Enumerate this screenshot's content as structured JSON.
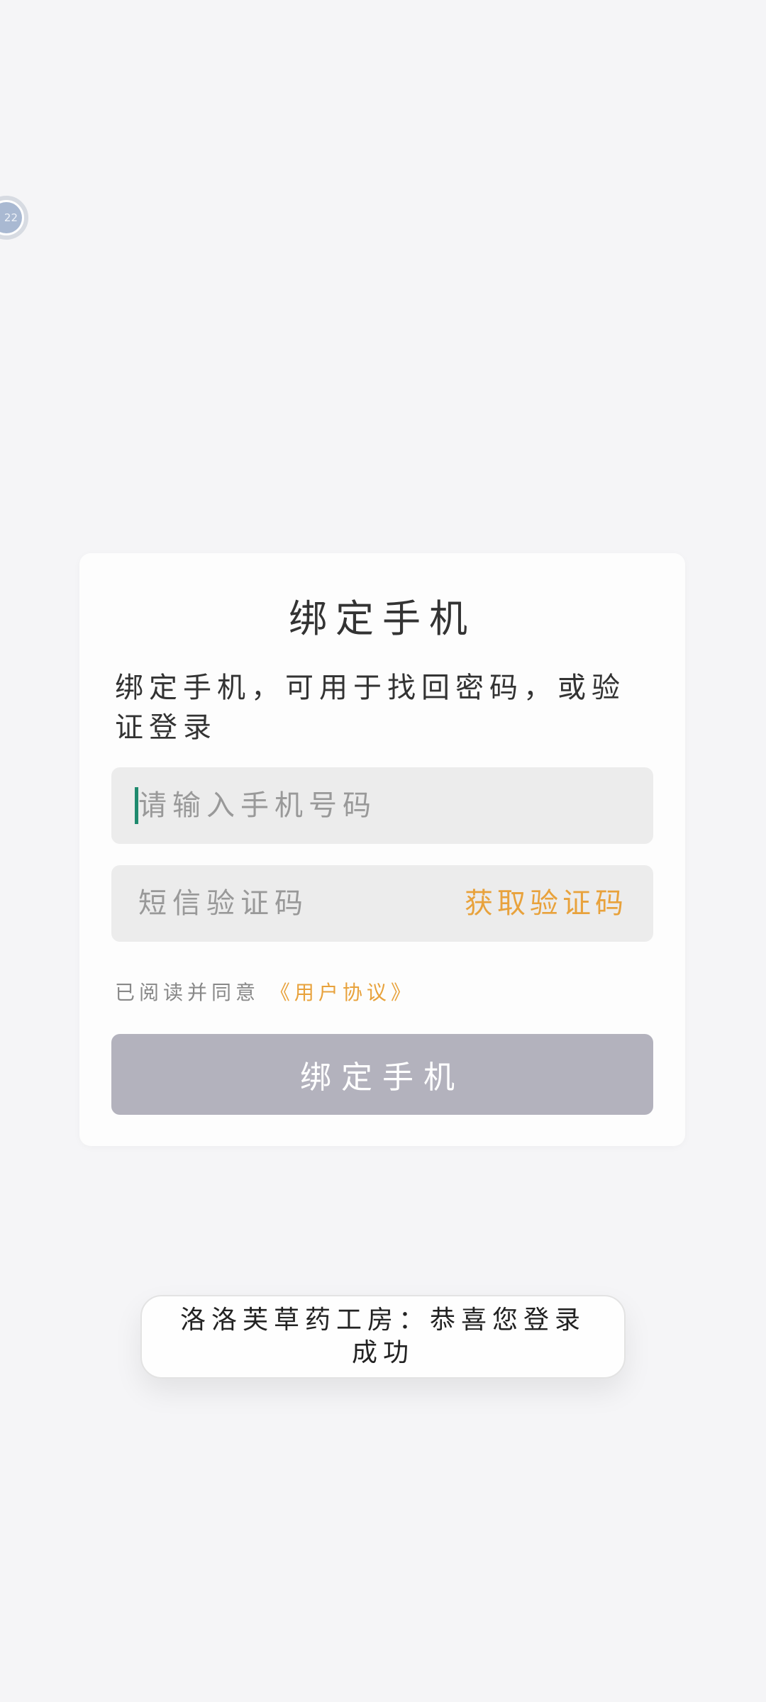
{
  "float_ball": {
    "label": "22"
  },
  "card": {
    "title": "绑定手机",
    "description": "绑定手机，可用于找回密码，或验证登录",
    "phone_input": {
      "placeholder": "请输入手机号码",
      "value": ""
    },
    "code_input": {
      "placeholder": "短信验证码",
      "value": ""
    },
    "get_code_label": "获取验证码",
    "agreement": {
      "prefix": "已阅读并同意",
      "link": "《用户协议》"
    },
    "submit_label": "绑定手机"
  },
  "toast": {
    "message": "洛洛芙草药工房：恭喜您登录成功"
  },
  "colors": {
    "accent": "#e8a23c",
    "button_disabled": "#b3b2bd",
    "cursor": "#1f8a6e",
    "input_bg": "#ececec",
    "page_bg": "#f5f5f7"
  }
}
